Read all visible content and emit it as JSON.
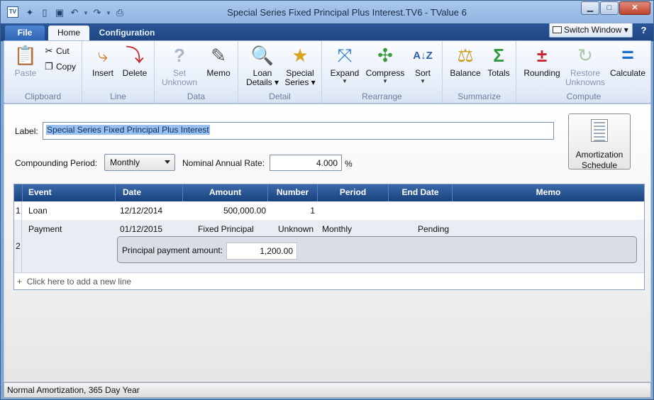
{
  "window": {
    "title": "Special Series Fixed Principal Plus Interest.TV6 - TValue 6",
    "app_icon": "TV",
    "controls": {
      "minimize": "▁",
      "maximize": "□",
      "close": "✕"
    }
  },
  "quick_access": {
    "icons": [
      "new-icon",
      "open-icon",
      "save-icon",
      "undo-icon",
      "redo-icon",
      "print-icon"
    ]
  },
  "tabs": {
    "file": "File",
    "home": "Home",
    "configuration": "Configuration",
    "active": "Home"
  },
  "switch_window": "Switch Window",
  "help": "?",
  "ribbon": {
    "clipboard": {
      "label": "Clipboard",
      "paste": "Paste",
      "cut": "Cut",
      "copy": "Copy"
    },
    "line": {
      "label": "Line",
      "insert": "Insert",
      "delete": "Delete"
    },
    "data": {
      "label": "Data",
      "set_unknown_1": "Set",
      "set_unknown_2": "Unknown",
      "memo": "Memo"
    },
    "detail": {
      "label": "Detail",
      "loan_details_1": "Loan",
      "loan_details_2": "Details",
      "special_series_1": "Special",
      "special_series_2": "Series"
    },
    "rearrange": {
      "label": "Rearrange",
      "expand": "Expand",
      "compress": "Compress",
      "sort": "Sort"
    },
    "summarize": {
      "label": "Summarize",
      "balance": "Balance",
      "totals": "Totals"
    },
    "compute": {
      "label": "Compute",
      "rounding": "Rounding",
      "restore_unknowns_1": "Restore",
      "restore_unknowns_2": "Unknowns",
      "calculate": "Calculate"
    }
  },
  "form": {
    "label_caption": "Label:",
    "label_value": "Special Series Fixed Principal Plus Interest",
    "compounding_caption": "Compounding Period:",
    "compounding_value": "Monthly",
    "rate_caption": "Nominal Annual Rate:",
    "rate_value": "4.000",
    "rate_unit": "%",
    "amortization_1": "Amortization",
    "amortization_2": "Schedule"
  },
  "grid": {
    "columns": [
      "Event",
      "Date",
      "Amount",
      "Number",
      "Period",
      "End Date",
      "Memo"
    ],
    "rows": [
      {
        "num": "1",
        "event": "Loan",
        "date": "12/12/2014",
        "amount": "500,000.00",
        "number": "1",
        "period": "",
        "end_date": ""
      },
      {
        "num": "2",
        "event": "Payment",
        "date": "01/12/2015",
        "amount": "Fixed Principal",
        "number": "Unknown",
        "period": "Monthly",
        "end_date": "Pending"
      }
    ],
    "detail_caption": "Principal payment amount:",
    "detail_value": "1,200.00",
    "add_line": "Click here to add a new line",
    "add_line_icon": "+"
  },
  "status": "Normal Amortization, 365 Day Year",
  "colors": {
    "header_blue": "#17427e",
    "tab_blue": "#1e4680",
    "selection": "#99c1ef"
  }
}
